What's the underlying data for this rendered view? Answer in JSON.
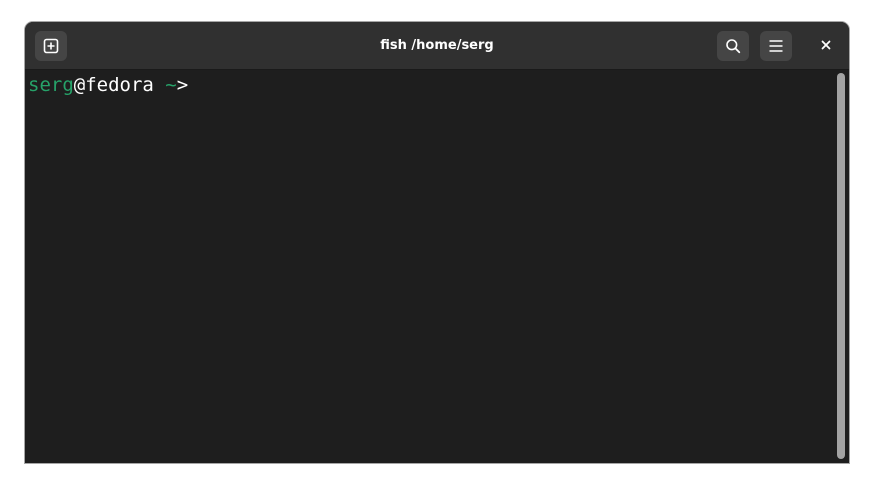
{
  "window": {
    "title": "fish /home/serg"
  },
  "header": {
    "new_tab_icon": "tab-new-icon",
    "search_icon": "search-icon",
    "menu_icon": "hamburger-menu-icon",
    "close_icon": "close-icon"
  },
  "terminal": {
    "user": "serg",
    "at_host": "@fedora",
    "space": " ",
    "cwd": "~",
    "prompt_char": ">"
  },
  "colors": {
    "background": "#1e1e1e",
    "header": "#303030",
    "prompt_green": "#26a269",
    "scrollbar": "#a3a3a3"
  }
}
